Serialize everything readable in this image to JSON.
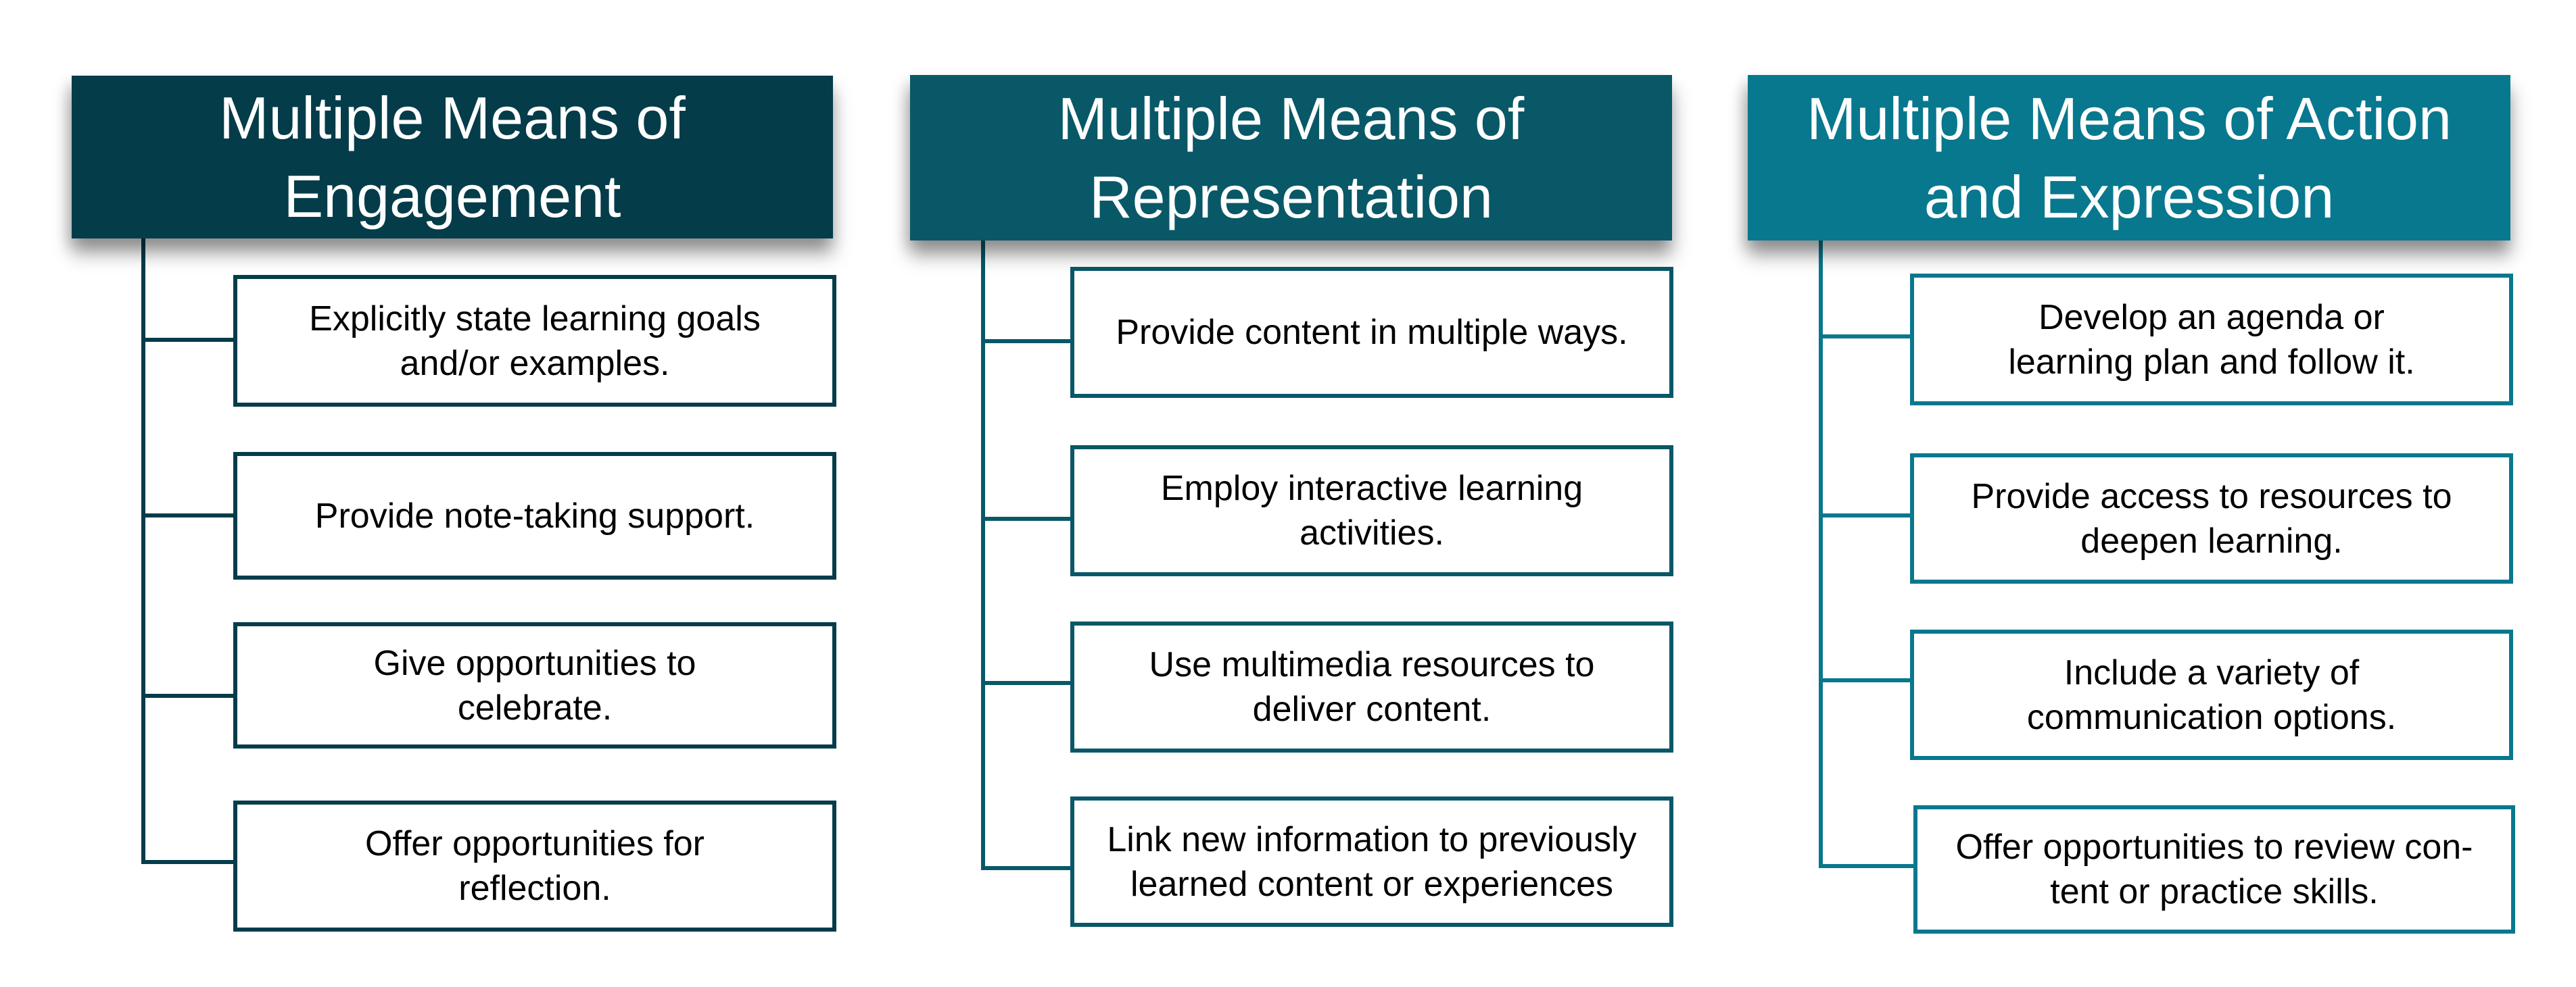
{
  "colors": {
    "engagement": "#043c4a",
    "representation": "#085868",
    "action_expression": "#08788e",
    "box_fill": "#ffffff",
    "text_dark": "#000000",
    "text_light": "#ffffff"
  },
  "columns": [
    {
      "title_lines": [
        "Multiple Means of",
        "Engagement"
      ],
      "items": [
        {
          "lines": [
            "Explicitly state learning goals",
            "and/or examples."
          ]
        },
        {
          "lines": [
            "Provide note-taking support."
          ]
        },
        {
          "lines": [
            "Give opportunities to",
            "celebrate."
          ]
        },
        {
          "lines": [
            "Offer opportunities for",
            "reflection."
          ]
        }
      ]
    },
    {
      "title_lines": [
        "Multiple Means of",
        "Representation"
      ],
      "items": [
        {
          "lines": [
            "Provide content in multiple ways."
          ]
        },
        {
          "lines": [
            "Employ interactive learning",
            "activities."
          ]
        },
        {
          "lines": [
            "Use multimedia resources to",
            "deliver content."
          ]
        },
        {
          "lines": [
            "Link new information to previously",
            "learned content or experiences"
          ]
        }
      ]
    },
    {
      "title_lines": [
        "Multiple Means of Action",
        "and Expression"
      ],
      "items": [
        {
          "lines": [
            "Develop an agenda or",
            "learning plan and follow it."
          ]
        },
        {
          "lines": [
            "Provide access to resources to",
            "deepen learning."
          ]
        },
        {
          "lines": [
            "Include a variety of",
            "communication options."
          ]
        },
        {
          "lines": [
            "Offer opportunities to review con-",
            "tent or practice skills."
          ]
        }
      ]
    }
  ]
}
